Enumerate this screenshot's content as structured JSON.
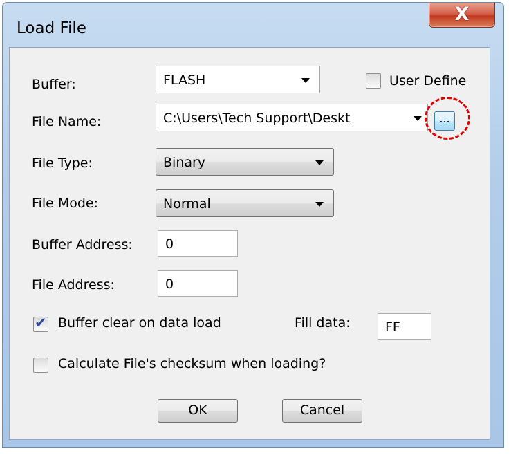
{
  "window": {
    "title": "Load File",
    "close_symbol": "X"
  },
  "buffer": {
    "label": "Buffer:",
    "value": "FLASH"
  },
  "user_define": {
    "label": "User Define",
    "checked": false
  },
  "file_name": {
    "label": "File Name:",
    "value": "C:\\Users\\Tech Support\\Deskt",
    "browse_label": "..."
  },
  "file_type": {
    "label": "File Type:",
    "value": "Binary"
  },
  "file_mode": {
    "label": "File Mode:",
    "value": "Normal"
  },
  "buffer_address": {
    "label": "Buffer Address:",
    "value": "0"
  },
  "file_address": {
    "label": "File Address:",
    "value": "0"
  },
  "buffer_clear": {
    "label": "Buffer clear on data load",
    "checked": true
  },
  "fill_data": {
    "label": "Fill data:",
    "value": "FF"
  },
  "checksum": {
    "label": "Calculate File's checksum when loading?",
    "checked": false
  },
  "buttons": {
    "ok": "OK",
    "cancel": "Cancel"
  },
  "colors": {
    "highlight": "#e00000",
    "checkmark": "#2a4a9c"
  }
}
